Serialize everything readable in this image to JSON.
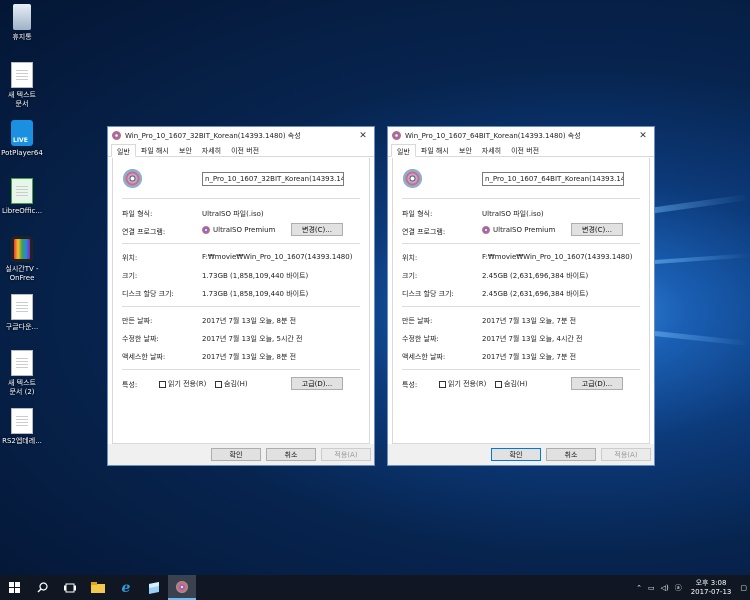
{
  "desktop": {
    "icons": [
      {
        "label": "휴지통",
        "icon": "recycle-bin-icon"
      },
      {
        "label": "새 텍스트\n문서",
        "icon": "text-document-icon"
      },
      {
        "label": "PotPlayer64",
        "icon": "potplayer-icon",
        "badge": "LIVE"
      },
      {
        "label": "LibreOffic...",
        "icon": "libreoffice-calc-icon"
      },
      {
        "label": "실시간TV -\nOnFree",
        "icon": "onfree-tv-icon"
      },
      {
        "label": "구글다운...",
        "icon": "text-document-icon"
      },
      {
        "label": "새 텍스트\n문서 (2)",
        "icon": "text-document-icon"
      },
      {
        "label": "RS2엡데레...",
        "icon": "text-document-icon"
      }
    ]
  },
  "dialogs": [
    {
      "title": "Win_Pro_10_1607_32BIT_Korean(14393.1480) 속성",
      "tabs": [
        "일반",
        "파일 해시",
        "보안",
        "자세히",
        "이전 버전"
      ],
      "filename": "n_Pro_10_1607_32BIT_Korean(14393.1480)",
      "file_type_label": "파일 형식:",
      "file_type": "UltraISO 파일(.iso)",
      "open_with_label": "연결 프로그램:",
      "open_with": "UltraISO Premium",
      "change_button": "변경(C)...",
      "location_label": "위치:",
      "location": "F:₩movie₩Win_Pro_10_1607(14393.1480)",
      "size_label": "크기:",
      "size": "1.73GB (1,858,109,440 바이트)",
      "disk_size_label": "디스크 할당 크기:",
      "disk_size": "1.73GB (1,858,109,440 바이트)",
      "created_label": "만든 날짜:",
      "created": "2017년 7월 13일 오늘, 8분 전",
      "modified_label": "수정한 날짜:",
      "modified": "2017년 7월 13일 오늘, 5시간 전",
      "accessed_label": "액세스한 날짜:",
      "accessed": "2017년 7월 13일 오늘, 8분 전",
      "attributes_label": "특성:",
      "readonly": "읽기 전용(R)",
      "hidden": "숨김(H)",
      "advanced_button": "고급(D)...",
      "ok": "확인",
      "cancel": "취소",
      "apply": "적용(A)"
    },
    {
      "title": "Win_Pro_10_1607_64BIT_Korean(14393.1480) 속성",
      "tabs": [
        "일반",
        "파일 해시",
        "보안",
        "자세히",
        "이전 버전"
      ],
      "filename": "n_Pro_10_1607_64BIT_Korean(14393.1480)",
      "file_type_label": "파일 형식:",
      "file_type": "UltraISO 파일(.iso)",
      "open_with_label": "연결 프로그램:",
      "open_with": "UltraISO Premium",
      "change_button": "변경(C)...",
      "location_label": "위치:",
      "location": "F:₩movie₩Win_Pro_10_1607(14393.1480)",
      "size_label": "크기:",
      "size": "2.45GB (2,631,696,384 바이트)",
      "disk_size_label": "디스크 할당 크기:",
      "disk_size": "2.45GB (2,631,696,384 바이트)",
      "created_label": "만든 날짜:",
      "created": "2017년 7월 13일 오늘, 7분 전",
      "modified_label": "수정한 날짜:",
      "modified": "2017년 7월 13일 오늘, 4시간 전",
      "accessed_label": "액세스한 날짜:",
      "accessed": "2017년 7월 13일 오늘, 7분 전",
      "attributes_label": "특성:",
      "readonly": "읽기 전용(R)",
      "hidden": "숨김(H)",
      "advanced_button": "고급(D)...",
      "ok": "확인",
      "cancel": "취소",
      "apply": "적용(A)"
    }
  ],
  "taskbar": {
    "time": "오후 3:08",
    "date": "2017-07-13",
    "tray_icons": [
      "chevron-up-icon",
      "network-icon",
      "volume-icon",
      "ime-icon",
      "notification-icon"
    ]
  }
}
